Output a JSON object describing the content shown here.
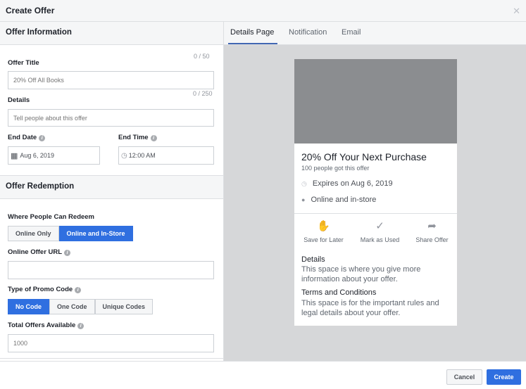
{
  "dialog": {
    "title": "Create Offer"
  },
  "left": {
    "offer_info": "Offer Information",
    "title_label": "Offer Title",
    "title_count": "0 / 50",
    "title_placeholder": "20% Off All Books",
    "details_label": "Details",
    "details_count": "0 / 250",
    "details_placeholder": "Tell people about this offer",
    "end_date_label": "End Date",
    "end_date": "Aug 6, 2019",
    "end_time_label": "End Time",
    "end_time": "12:00 AM",
    "redemption": "Offer Redemption",
    "where_label": "Where People Can Redeem",
    "where_options": [
      "Online Only",
      "Online and In-Store"
    ],
    "url_label": "Online Offer URL",
    "url_value": "",
    "promo_label": "Type of Promo Code",
    "promo_options": [
      "No Code",
      "One Code",
      "Unique Codes"
    ],
    "total_label": "Total Offers Available",
    "total_placeholder": "1000"
  },
  "tabs": [
    "Details Page",
    "Notification",
    "Email"
  ],
  "preview": {
    "title": "20% Off Your Next Purchase",
    "subtitle": "100 people got this offer",
    "expires": "Expires on Aug 6, 2019",
    "location": "Online and in-store",
    "actions": [
      "Save for Later",
      "Mark as Used",
      "Share Offer"
    ],
    "details_heading": "Details",
    "details_text": "This space is where you give more information about your offer.",
    "terms_heading": "Terms and Conditions",
    "terms_text": "This space is for the important rules and legal details about your offer."
  },
  "footer": {
    "cancel": "Cancel",
    "create": "Create"
  },
  "colors": {
    "accent": "#2f6fe0",
    "tab_underline": "#4267b2"
  }
}
